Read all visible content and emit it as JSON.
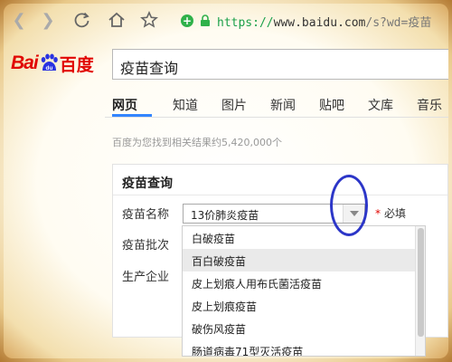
{
  "browser": {
    "url_scheme": "https://",
    "url_host": "www.baidu.com",
    "url_rest": "/s?wd=疫苗"
  },
  "search": {
    "logo_text": "Bai",
    "logo_du": "du",
    "logo_cn": "百度",
    "query": "疫苗查询"
  },
  "tabs": [
    "网页",
    "知道",
    "图片",
    "新闻",
    "贴吧",
    "文库",
    "音乐"
  ],
  "results": {
    "count_text": "百度为您找到相关结果约5,420,000个"
  },
  "card": {
    "title": "疫苗查询",
    "fields": {
      "name_label": "疫苗名称",
      "batch_label": "疫苗批次",
      "maker_label": "生产企业"
    },
    "selected_vaccine": "13价肺炎疫苗",
    "required_mark": "*",
    "required_text": "必填",
    "dropdown_options": [
      "白破疫苗",
      "百白破疫苗",
      "皮上划痕人用布氏菌活疫苗",
      "皮上划痕疫苗",
      "破伤风疫苗",
      "肠道病毒71型灭活疫苗"
    ]
  },
  "colors": {
    "accent": "#3385ff",
    "logo_red": "#e10601",
    "annotation": "#2c36c8"
  }
}
